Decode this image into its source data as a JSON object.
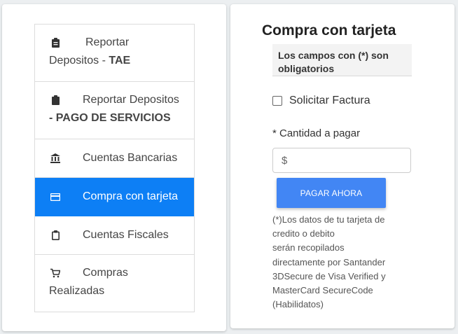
{
  "menu": {
    "items": [
      {
        "icon": "clipboard-icon",
        "line1": "Reportar",
        "line2_prefix": "Depositos - ",
        "line2_bold": "TAE"
      },
      {
        "icon": "clipboard-icon",
        "line1": "Reportar Depositos",
        "line2_bold": "- PAGO DE SERVICIOS"
      },
      {
        "icon": "bank-icon",
        "label": "Cuentas Bancarias"
      },
      {
        "icon": "credit-card-icon",
        "label": "Compra con tarjeta",
        "active": true
      },
      {
        "icon": "clipboard-outline-icon",
        "label": "Cuentas Fiscales"
      },
      {
        "icon": "cart-icon",
        "line1": "Compras",
        "line2_prefix": "Realizadas"
      }
    ]
  },
  "form": {
    "title": "Compra con tarjeta",
    "required_note": "Los campos con (*) son obligatorios",
    "invoice_label": "Solicitar Factura",
    "amount_label": "* Cantidad a pagar",
    "amount_prefix": "$",
    "amount_value": "",
    "pay_button": "PAGAR AHORA",
    "disclaimer": [
      "(*)Los datos de tu tarjeta de",
      "credito o debito",
      "serán recopilados",
      "directamente por Santander",
      "3DSecure de Visa Verified y",
      "MasterCard SecureCode",
      "(Habilidatos)"
    ]
  },
  "colors": {
    "active": "#0d7ff5",
    "button": "#4286f4"
  }
}
